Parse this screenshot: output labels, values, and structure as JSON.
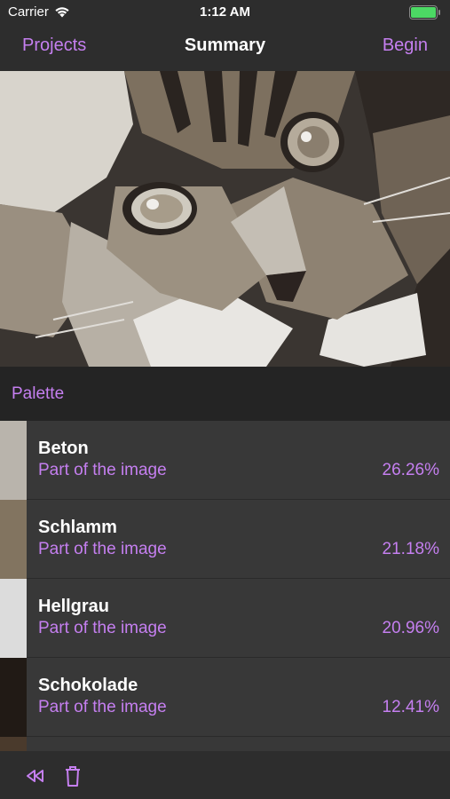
{
  "status_bar": {
    "carrier": "Carrier",
    "time": "1:12 AM",
    "wifi_icon": "wifi-icon",
    "battery_icon": "battery-full-icon",
    "battery_color": "#4cd964"
  },
  "nav": {
    "left_label": "Projects",
    "title": "Summary",
    "right_label": "Begin"
  },
  "palette": {
    "title": "Palette",
    "items": [
      {
        "name": "Beton",
        "subtitle": "Part of the image",
        "percent": "26.26%",
        "color": "#b9b4ac"
      },
      {
        "name": "Schlamm",
        "subtitle": "Part of the image",
        "percent": "21.18%",
        "color": "#827460"
      },
      {
        "name": "Hellgrau",
        "subtitle": "Part of the image",
        "percent": "20.96%",
        "color": "#dcdcdc"
      },
      {
        "name": "Schokolade",
        "subtitle": "Part of the image",
        "percent": "12.41%",
        "color": "#211a15"
      }
    ]
  },
  "toolbar": {
    "rewind_icon": "rewind-icon",
    "trash_icon": "trash-icon"
  },
  "colors": {
    "accent": "#c57ff0",
    "background": "#2d2d2d",
    "row_background": "#383838"
  }
}
